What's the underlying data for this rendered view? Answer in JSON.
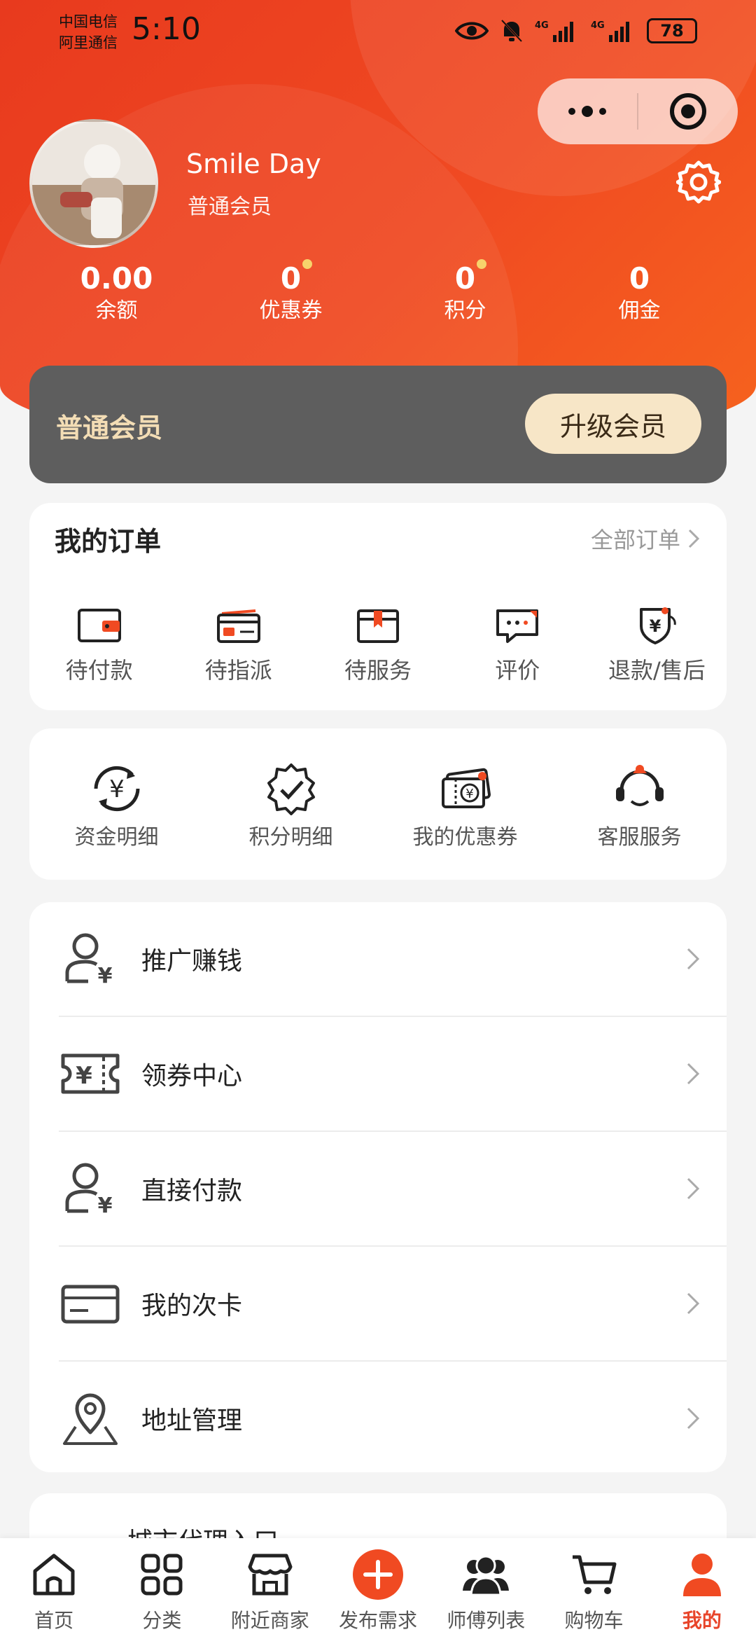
{
  "status_bar": {
    "carrier1": "中国电信",
    "carrier2": "阿里通信",
    "time": "5:10",
    "battery": "78"
  },
  "colors": {
    "accent": "#e8452a",
    "header_start": "#e83a1e",
    "header_end": "#f6631e",
    "vip_card": "#5e5e5e",
    "vip_text": "#f3ddb5"
  },
  "profile": {
    "name": "Smile Day",
    "level": "普通会员"
  },
  "stats": [
    {
      "value": "0.00",
      "label": "余额"
    },
    {
      "value": "0",
      "label": "优惠券"
    },
    {
      "value": "0",
      "label": "积分"
    },
    {
      "value": "0",
      "label": "佣金"
    }
  ],
  "vip": {
    "title": "普通会员",
    "button": "升级会员"
  },
  "orders": {
    "title": "我的订单",
    "all_label": "全部订单",
    "items": [
      {
        "label": "待付款",
        "icon": "wallet-icon"
      },
      {
        "label": "待指派",
        "icon": "card-icon"
      },
      {
        "label": "待服务",
        "icon": "box-icon"
      },
      {
        "label": "评价",
        "icon": "comment-icon"
      },
      {
        "label": "退款/售后",
        "icon": "refund-shield-icon"
      }
    ]
  },
  "tools": [
    {
      "label": "资金明细",
      "icon": "yuan-refresh-icon"
    },
    {
      "label": "积分明细",
      "icon": "badge-check-icon"
    },
    {
      "label": "我的优惠券",
      "icon": "coupon-icon"
    },
    {
      "label": "客服服务",
      "icon": "customer-service-icon"
    }
  ],
  "menu": [
    {
      "label": "推广赚钱",
      "icon": "user-yuan-icon"
    },
    {
      "label": "领券中心",
      "icon": "ticket-yuan-icon"
    },
    {
      "label": "直接付款",
      "icon": "user-yuan-icon"
    },
    {
      "label": "我的次卡",
      "icon": "credit-card-icon"
    },
    {
      "label": "地址管理",
      "icon": "map-pin-icon"
    }
  ],
  "partial_item": {
    "label": "城市代理入口"
  },
  "tabs": [
    {
      "label": "首页",
      "icon": "home-icon"
    },
    {
      "label": "分类",
      "icon": "grid-icon"
    },
    {
      "label": "附近商家",
      "icon": "store-icon"
    },
    {
      "label": "发布需求",
      "icon": "plus-circle-icon"
    },
    {
      "label": "师傅列表",
      "icon": "workers-icon"
    },
    {
      "label": "购物车",
      "icon": "cart-icon"
    },
    {
      "label": "我的",
      "icon": "person-icon"
    }
  ]
}
